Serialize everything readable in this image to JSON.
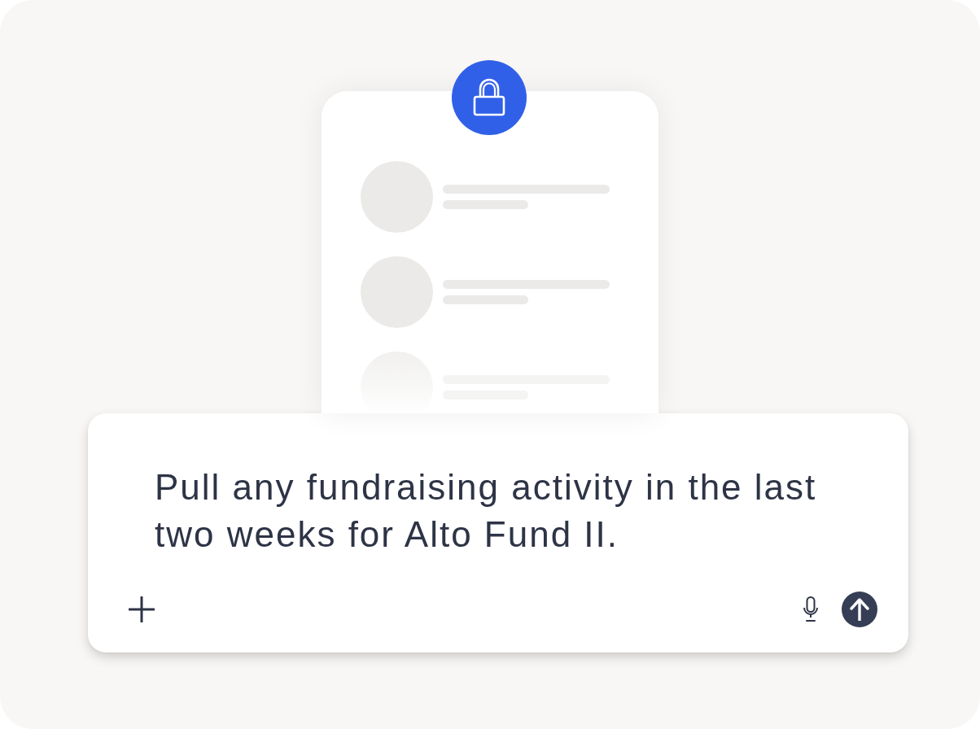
{
  "card": {
    "skeleton_rows": [
      {
        "faded": false
      },
      {
        "faded": false
      },
      {
        "faded": true
      }
    ]
  },
  "composer": {
    "value": "Pull any fundraising activity in the last two weeks for Alto Fund II."
  }
}
